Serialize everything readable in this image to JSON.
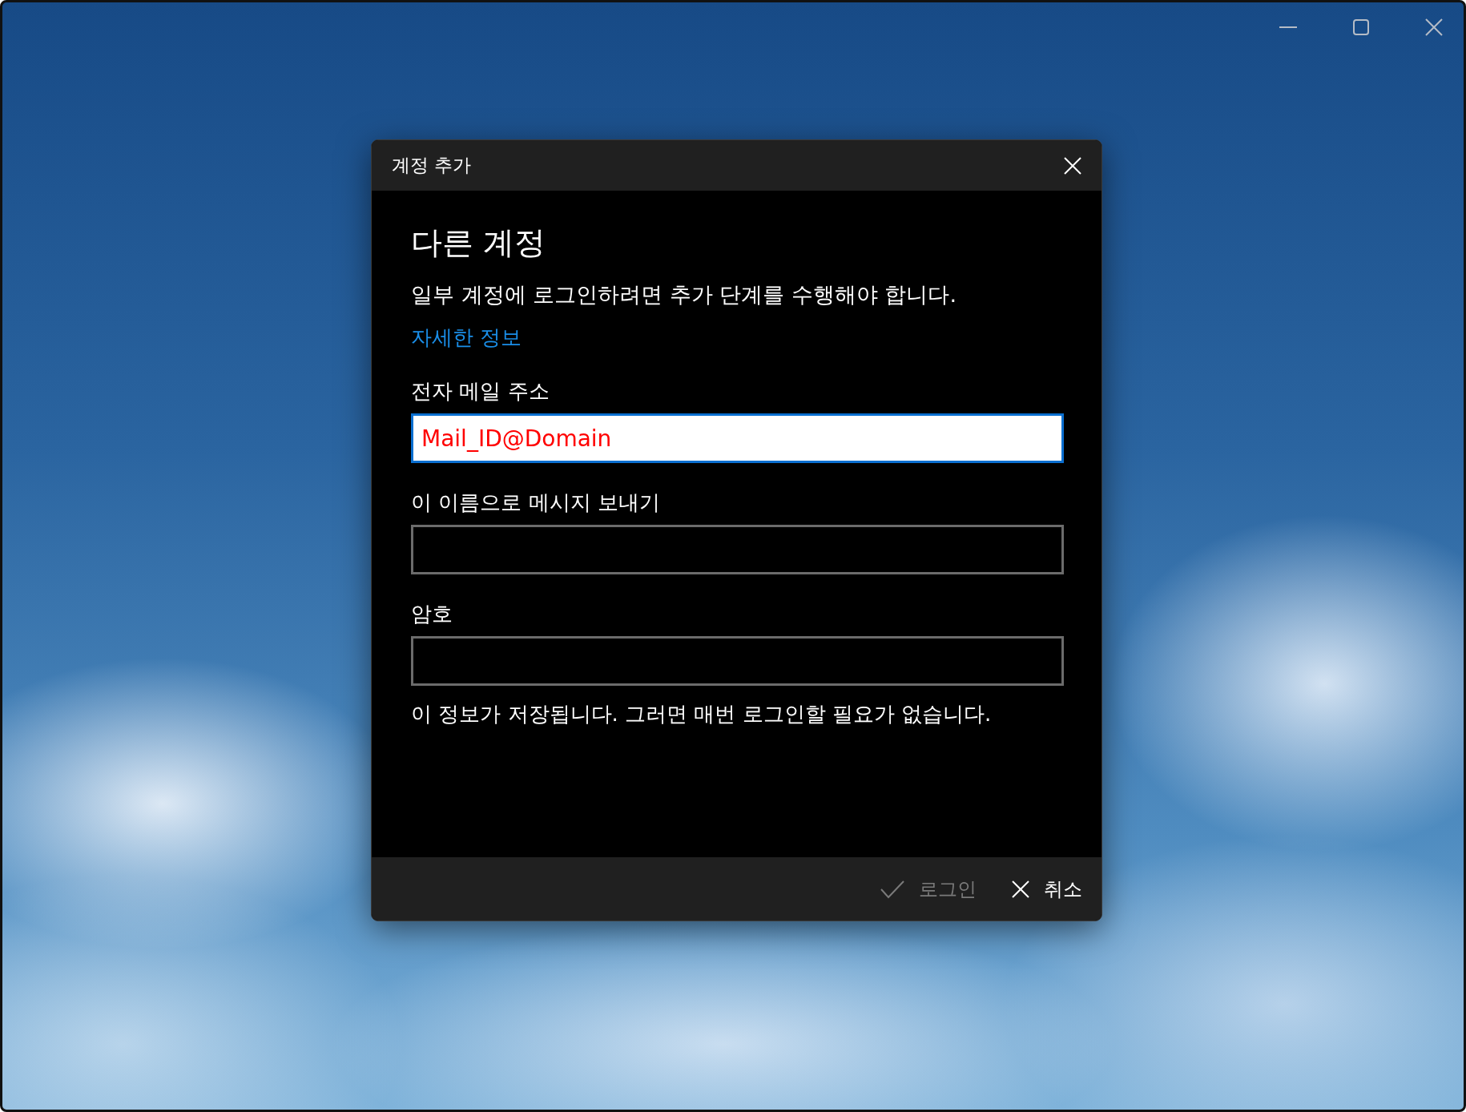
{
  "dialog": {
    "title": "계정 추가",
    "heading": "다른 계정",
    "description": "일부 계정에 로그인하려면 추가 단계를 수행해야 합니다.",
    "link": "자세한 정보",
    "fields": [
      {
        "label": "전자 메일 주소",
        "value": "Mail_ID@Domain",
        "focused": true
      },
      {
        "label": "이 이름으로 메시지 보내기",
        "focused": false
      },
      {
        "label": "암호",
        "focused": false
      }
    ],
    "note": "이 정보가 저장됩니다. 그러면 매번 로그인할 필요가 없습니다.",
    "buttons": [
      {
        "label": "로그인",
        "kind": "confirm",
        "disabled": true
      },
      {
        "label": "취소",
        "kind": "cancel",
        "disabled": false
      }
    ]
  }
}
